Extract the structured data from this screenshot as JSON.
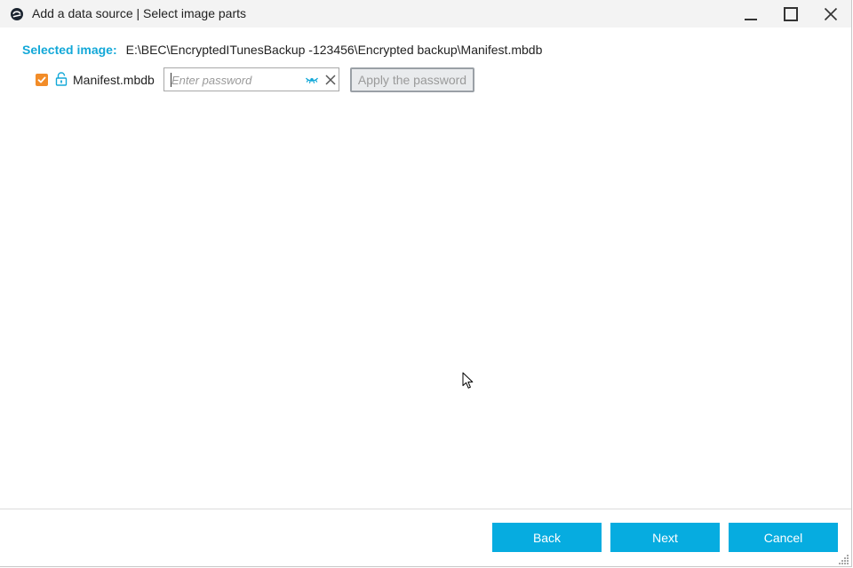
{
  "window": {
    "title": "Add a data source | Select image parts",
    "controls": {
      "minimize_icon": "minimize-icon",
      "maximize_icon": "maximize-icon",
      "close_icon": "close-icon"
    }
  },
  "selected_image": {
    "label": "Selected image:",
    "path": "E:\\BEC\\EncryptedITunesBackup -123456\\Encrypted backup\\Manifest.mbdb"
  },
  "parts": [
    {
      "name": "Manifest.mbdb",
      "checked": true,
      "password_value": "",
      "password_placeholder": "Enter password",
      "apply_label": "Apply the password",
      "apply_enabled": false
    }
  ],
  "footer": {
    "back_label": "Back",
    "next_label": "Next",
    "cancel_label": "Cancel"
  },
  "colors": {
    "accent": "#06ace0",
    "label_accent": "#13a8d8",
    "checkbox": "#f28c28",
    "titlebar_bg": "#f3f3f3"
  }
}
